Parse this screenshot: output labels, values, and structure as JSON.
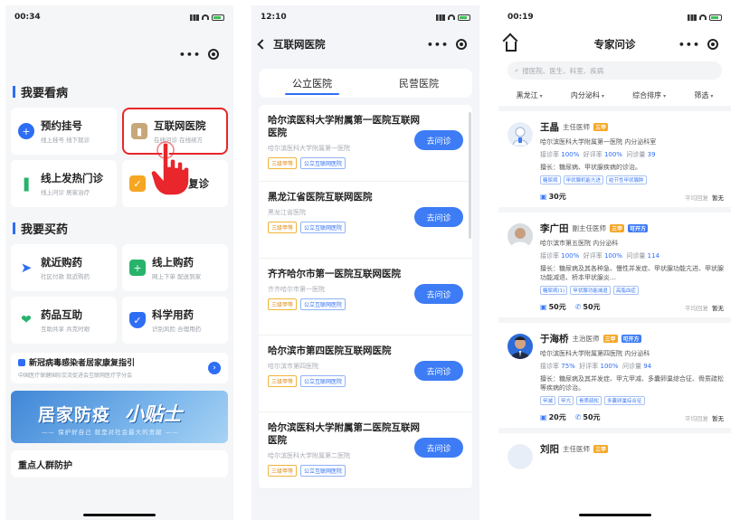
{
  "panel1": {
    "time": "00:34",
    "section_see": "我要看病",
    "tiles_see": [
      {
        "title": "预约挂号",
        "sub": "线上挂号 线下就诊",
        "color": "#2e6ef5",
        "icon": "plus-icon"
      },
      {
        "title": "互联网医院",
        "sub": "在线问诊 在线续方",
        "color": "#c8a77a",
        "icon": "hospital-icon"
      },
      {
        "title": "线上发热门诊",
        "sub": "线上问诊 居家治疗",
        "color": "#27b36b",
        "icon": "thermometer-icon"
      },
      {
        "title": "复诊",
        "sub": "",
        "color": "#f5a623",
        "icon": "clipboard-icon"
      }
    ],
    "section_buy": "我要买药",
    "tiles_buy": [
      {
        "title": "就近购药",
        "sub": "社区付款 就近购药",
        "color": "#2e6ef5",
        "icon": "location-arrow-icon"
      },
      {
        "title": "线上购药",
        "sub": "网上下单 配送到家",
        "color": "#27b36b",
        "icon": "cart-plus-icon"
      },
      {
        "title": "药品互助",
        "sub": "互助共享 共克时艰",
        "color": "#27b36b",
        "icon": "handshake-icon"
      },
      {
        "title": "科学用药",
        "sub": "识别风险 合理用药",
        "color": "#2e6ef5",
        "icon": "shield-icon"
      }
    ],
    "news_title": "新冠病毒感染者居家康复指引",
    "news_sub": "中国医疗保健国际交流促进会互联网医疗学分会",
    "banner_main": "居家防疫",
    "banner_accent": "小贴士",
    "banner_sub": "—— 保护好自己 就是对社会最大的贡献 ——",
    "focus_title": "重点人群防护"
  },
  "panel2": {
    "time": "12:10",
    "title": "互联网医院",
    "tabs": [
      "公立医院",
      "民营医院"
    ],
    "visit_label": "去问诊",
    "hospitals": [
      {
        "name": "哈尔滨医科大学附属第一医院互联网医院",
        "sub": "哈尔滨医科大学附属第一医院",
        "tags": [
          "三级甲等",
          "公立互联网医院"
        ]
      },
      {
        "name": "黑龙江省医院互联网医院",
        "sub": "黑龙江省医院",
        "tags": [
          "三级甲等",
          "公立互联网医院"
        ]
      },
      {
        "name": "齐齐哈尔市第一医院互联网医院",
        "sub": "齐齐哈尔市第一医院",
        "tags": [
          "三级甲等",
          "公立互联网医院"
        ]
      },
      {
        "name": "哈尔滨市第四医院互联网医院",
        "sub": "哈尔滨市第四医院",
        "tags": [
          "三级甲等",
          "公立互联网医院"
        ]
      },
      {
        "name": "哈尔滨医科大学附属第二医院互联网医院",
        "sub": "哈尔滨医科大学附属第二医院",
        "tags": [
          "三级甲等",
          "公立互联网医院"
        ]
      }
    ]
  },
  "panel3": {
    "time": "00:19",
    "title": "专家问诊",
    "search_placeholder": "搜医院、医生、科室、疾病",
    "filters": [
      "黑龙江",
      "内分泌科",
      "综合排序",
      "筛选"
    ],
    "reply_label": "平均回复",
    "reply_value": "暂无",
    "doctors": [
      {
        "name": "王晶",
        "title": "主任医师",
        "level": "三甲",
        "online": "",
        "hospital": "哈尔滨医科大学附属第一医院 内分泌科室",
        "recommend": "100%",
        "praise": "100%",
        "count": "39",
        "skill": "擅长：糖尿病、甲状腺疾病的诊治。",
        "tags": [
          "糖尿病",
          "甲状腺机能亢进",
          "结节性甲状腺肿"
        ],
        "prices": [
          "30元"
        ]
      },
      {
        "name": "李广田",
        "title": "副主任医师",
        "level": "三甲",
        "online": "可开方",
        "hospital": "哈尔滨市第五医院 内分泌科",
        "recommend": "100%",
        "praise": "100%",
        "count": "114",
        "skill": "擅长：糖尿病及其各种急、慢性并发症、甲状腺功能亢进、甲状腺功能减退、桥本甲状腺炎…",
        "tags": [
          "糖尿病(1)",
          "甲状腺功能减退",
          "高脂血症"
        ],
        "prices": [
          "50元",
          "50元"
        ]
      },
      {
        "name": "于海桥",
        "title": "主治医师",
        "level": "三甲",
        "online": "可开方",
        "hospital": "哈尔滨医科大学附属第四医院 内分泌科",
        "recommend": "75%",
        "praise": "100%",
        "count": "94",
        "skill": "擅长：糖尿病及其并发症、甲亢甲减、多囊卵巢综合征、骨质疏松等疾病的诊治。",
        "tags": [
          "甲减",
          "甲亢",
          "骨质疏松",
          "多囊卵巢综合征"
        ],
        "prices": [
          "20元",
          "50元"
        ]
      },
      {
        "name": "刘阳",
        "title": "主任医师",
        "level": "三甲",
        "online": ""
      }
    ],
    "stat_labels": [
      "接诊率",
      "好评率",
      "问诊量"
    ]
  }
}
